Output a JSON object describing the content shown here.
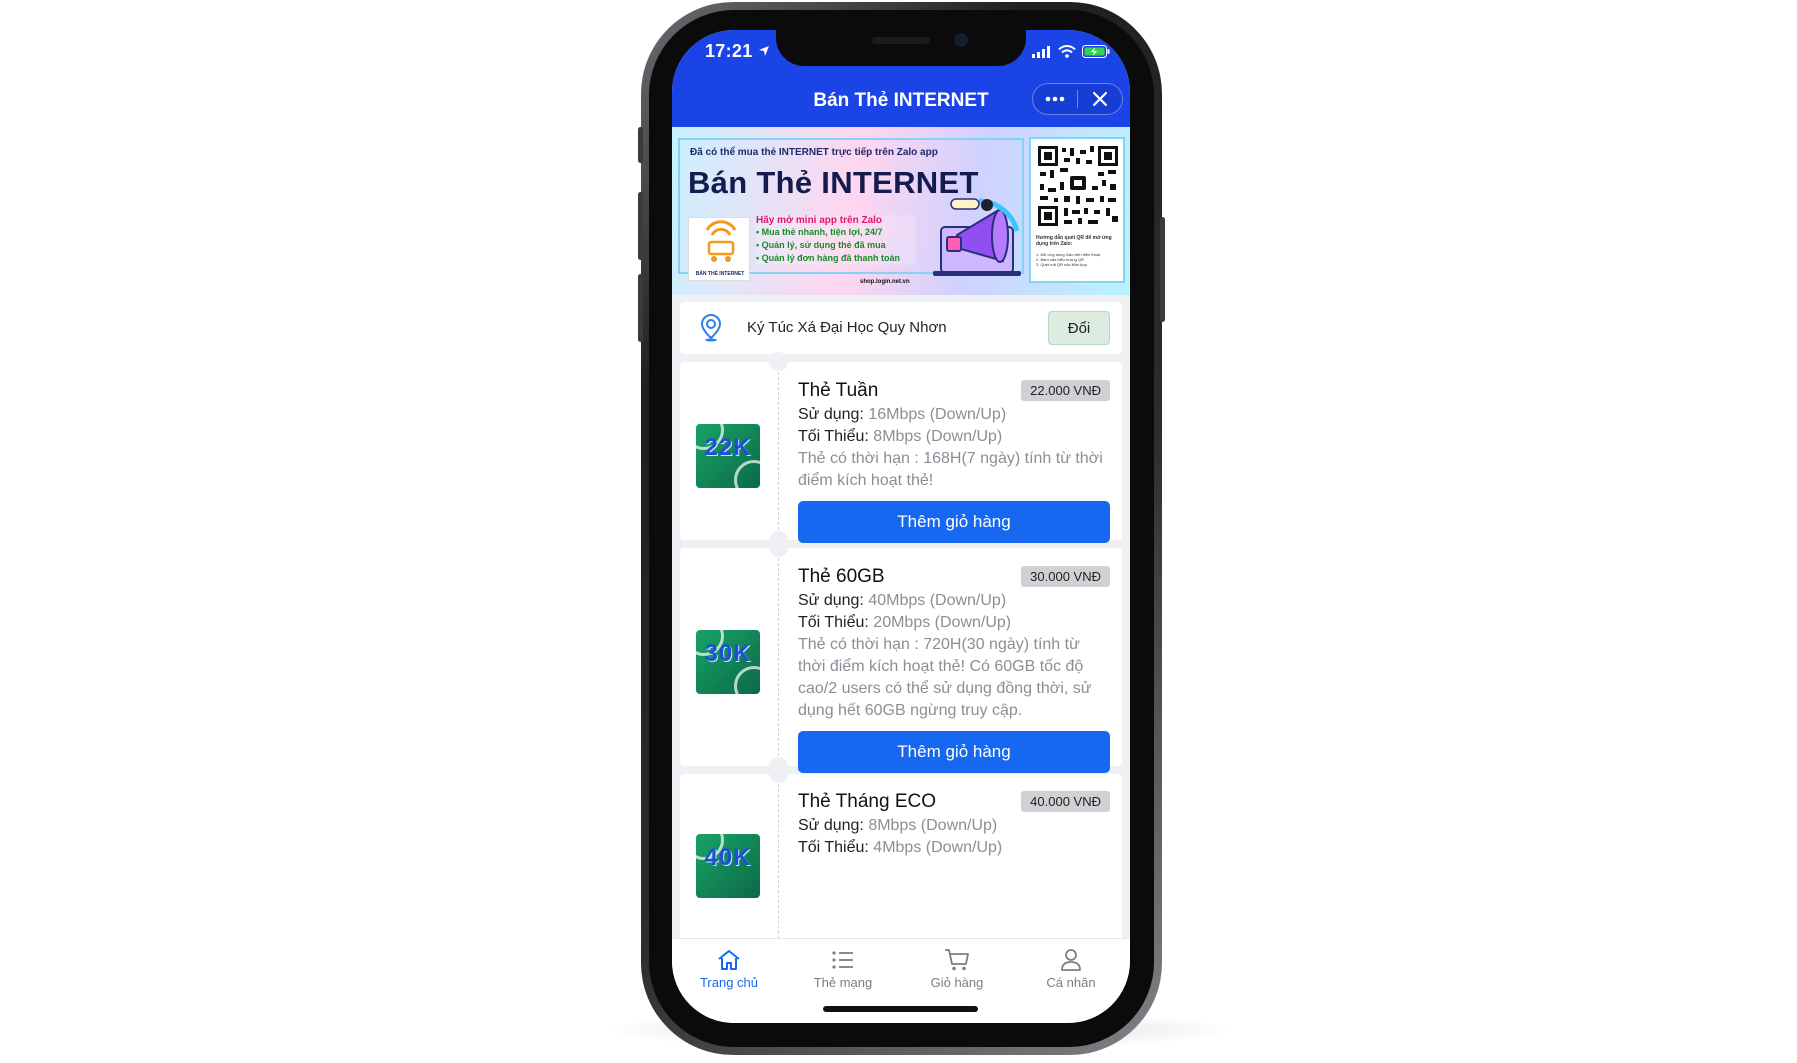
{
  "status": {
    "time": "17:21"
  },
  "header": {
    "title": "Bán Thẻ INTERNET",
    "more_icon": "more-dots-icon",
    "close_icon": "close-icon"
  },
  "banner": {
    "top_line": "Đã có thể mua thẻ INTERNET trực tiếp trên Zalo app",
    "title": "Bán Thẻ INTERNET",
    "logo_caption": "BÁN THẺ INTERNET",
    "bullets_title": "Hãy mở mini app trên Zalo",
    "bullets": [
      "• Mua thẻ nhanh, tiện lợi, 24/7",
      "• Quản lý, sử dụng thẻ đã mua",
      "• Quản lý đơn hàng đã thanh toán"
    ],
    "url": "shop.login.net.vn",
    "qr_caption": "Hướng dẫn quét QR để mở ứng dụng trên Zalo:",
    "qr_steps": [
      "1. Mở ứng dụng Zalo trên điện thoại",
      "2. Bấm vào biểu tượng QR",
      "3. Quét mã QR của Mini App"
    ]
  },
  "location": {
    "name": "Ký Túc Xá Đại Học Quy Nhơn",
    "change_label": "Đổi"
  },
  "products": [
    {
      "thumb_text": "22K",
      "name": "Thẻ Tuần",
      "price": "22.000 VNĐ",
      "usage_label": "Sử dụng:",
      "usage_value": " 16Mbps (Down/Up)",
      "min_label": "Tối Thiểu:",
      "min_value": " 8Mbps (Down/Up)",
      "desc": "Thẻ có thời hạn : 168H(7 ngày) tính từ thời điểm kích hoạt thẻ!",
      "button": "Thêm giỏ hàng"
    },
    {
      "thumb_text": "30K",
      "name": "Thẻ 60GB",
      "price": "30.000 VNĐ",
      "usage_label": "Sử dụng:",
      "usage_value": " 40Mbps (Down/Up)",
      "min_label": "Tối Thiểu:",
      "min_value": " 20Mbps (Down/Up)",
      "desc": "Thẻ có thời hạn : 720H(30 ngày) tính từ thời điểm kích hoạt thẻ! Có 60GB tốc độ cao/2 users có thể sử dụng đồng thời, sử dụng hết 60GB ngừng truy cập.",
      "button": "Thêm giỏ hàng"
    },
    {
      "thumb_text": "40K",
      "name": "Thẻ Tháng ECO",
      "price": "40.000 VNĐ",
      "usage_label": "Sử dụng:",
      "usage_value": " 8Mbps (Down/Up)",
      "min_label": "Tối Thiểu:",
      "min_value": " 4Mbps (Down/Up)"
    }
  ],
  "tabs": [
    {
      "label": "Trang chủ",
      "icon": "home-icon",
      "active": true
    },
    {
      "label": "Thẻ mạng",
      "icon": "list-icon",
      "active": false
    },
    {
      "label": "Giỏ hàng",
      "icon": "cart-icon",
      "active": false
    },
    {
      "label": "Cá nhân",
      "icon": "user-icon",
      "active": false
    }
  ],
  "colors": {
    "header_bg": "#1a44e6",
    "primary_button": "#1768f0",
    "tab_active": "#1768f0"
  }
}
